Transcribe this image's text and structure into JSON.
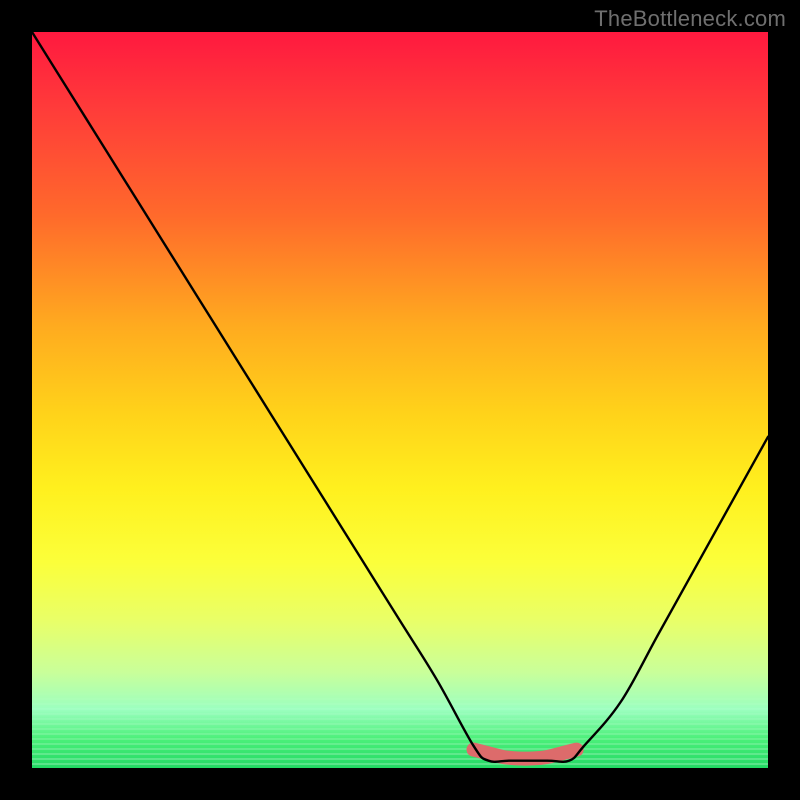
{
  "attribution": "TheBottleneck.com",
  "chart_data": {
    "type": "line",
    "title": "",
    "xlabel": "",
    "ylabel": "",
    "xlim": [
      0,
      100
    ],
    "ylim": [
      0,
      100
    ],
    "series": [
      {
        "name": "bottleneck-curve",
        "x": [
          0,
          5,
          10,
          15,
          20,
          25,
          30,
          35,
          40,
          45,
          50,
          55,
          60,
          62,
          65,
          70,
          73,
          75,
          80,
          85,
          90,
          95,
          100
        ],
        "values": [
          100,
          92,
          84,
          76,
          68,
          60,
          52,
          44,
          36,
          28,
          20,
          12,
          3,
          1,
          1,
          1,
          1,
          3,
          9,
          18,
          27,
          36,
          45
        ]
      },
      {
        "name": "sweet-spot-marker",
        "x": [
          60,
          62,
          64,
          66,
          68,
          70,
          72,
          74
        ],
        "values": [
          2.5,
          2,
          1.5,
          1.3,
          1.3,
          1.5,
          2,
          2.5
        ]
      }
    ],
    "colors": {
      "curve": "#000000",
      "marker": "#dd6b6b",
      "marker_dot": "#dd6b6b"
    }
  }
}
